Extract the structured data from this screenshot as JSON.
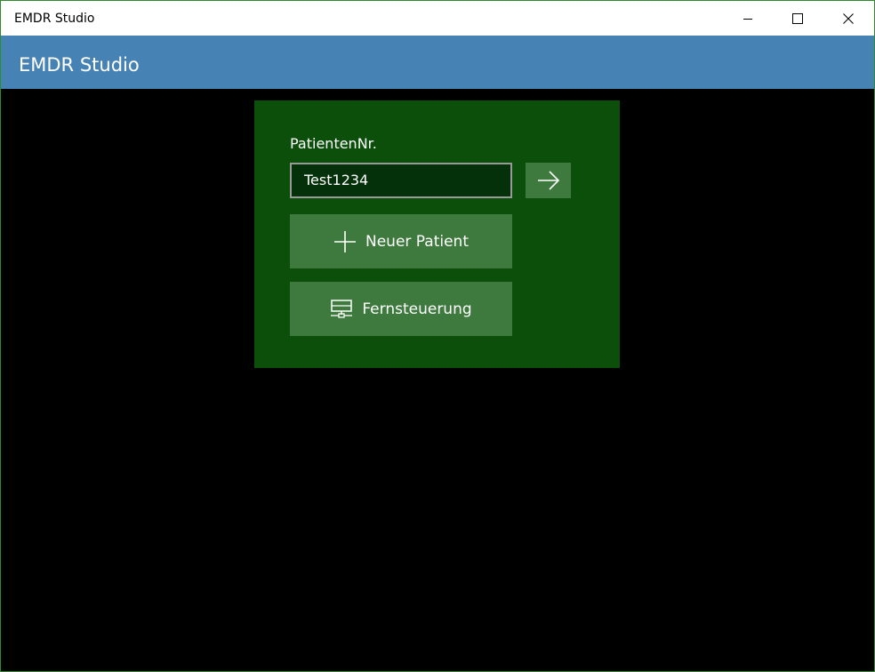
{
  "window": {
    "title": "EMDR Studio",
    "controls": {
      "minimize": "minimize-icon",
      "maximize": "maximize-icon",
      "close": "close-icon"
    }
  },
  "appbar": {
    "title": "EMDR Studio"
  },
  "login": {
    "patient_label": "PatientenNr.",
    "patient_value": "Test1234",
    "go_icon": "arrow-right-icon",
    "new_patient_label": "Neuer Patient",
    "new_patient_icon": "plus-icon",
    "remote_label": "Fernsteuerung",
    "remote_icon": "network-monitor-icon"
  },
  "colors": {
    "appbar": "#4682b4",
    "panel": "#0b4f0b",
    "button": "#3e7a3e",
    "input_bg": "#04310a"
  }
}
